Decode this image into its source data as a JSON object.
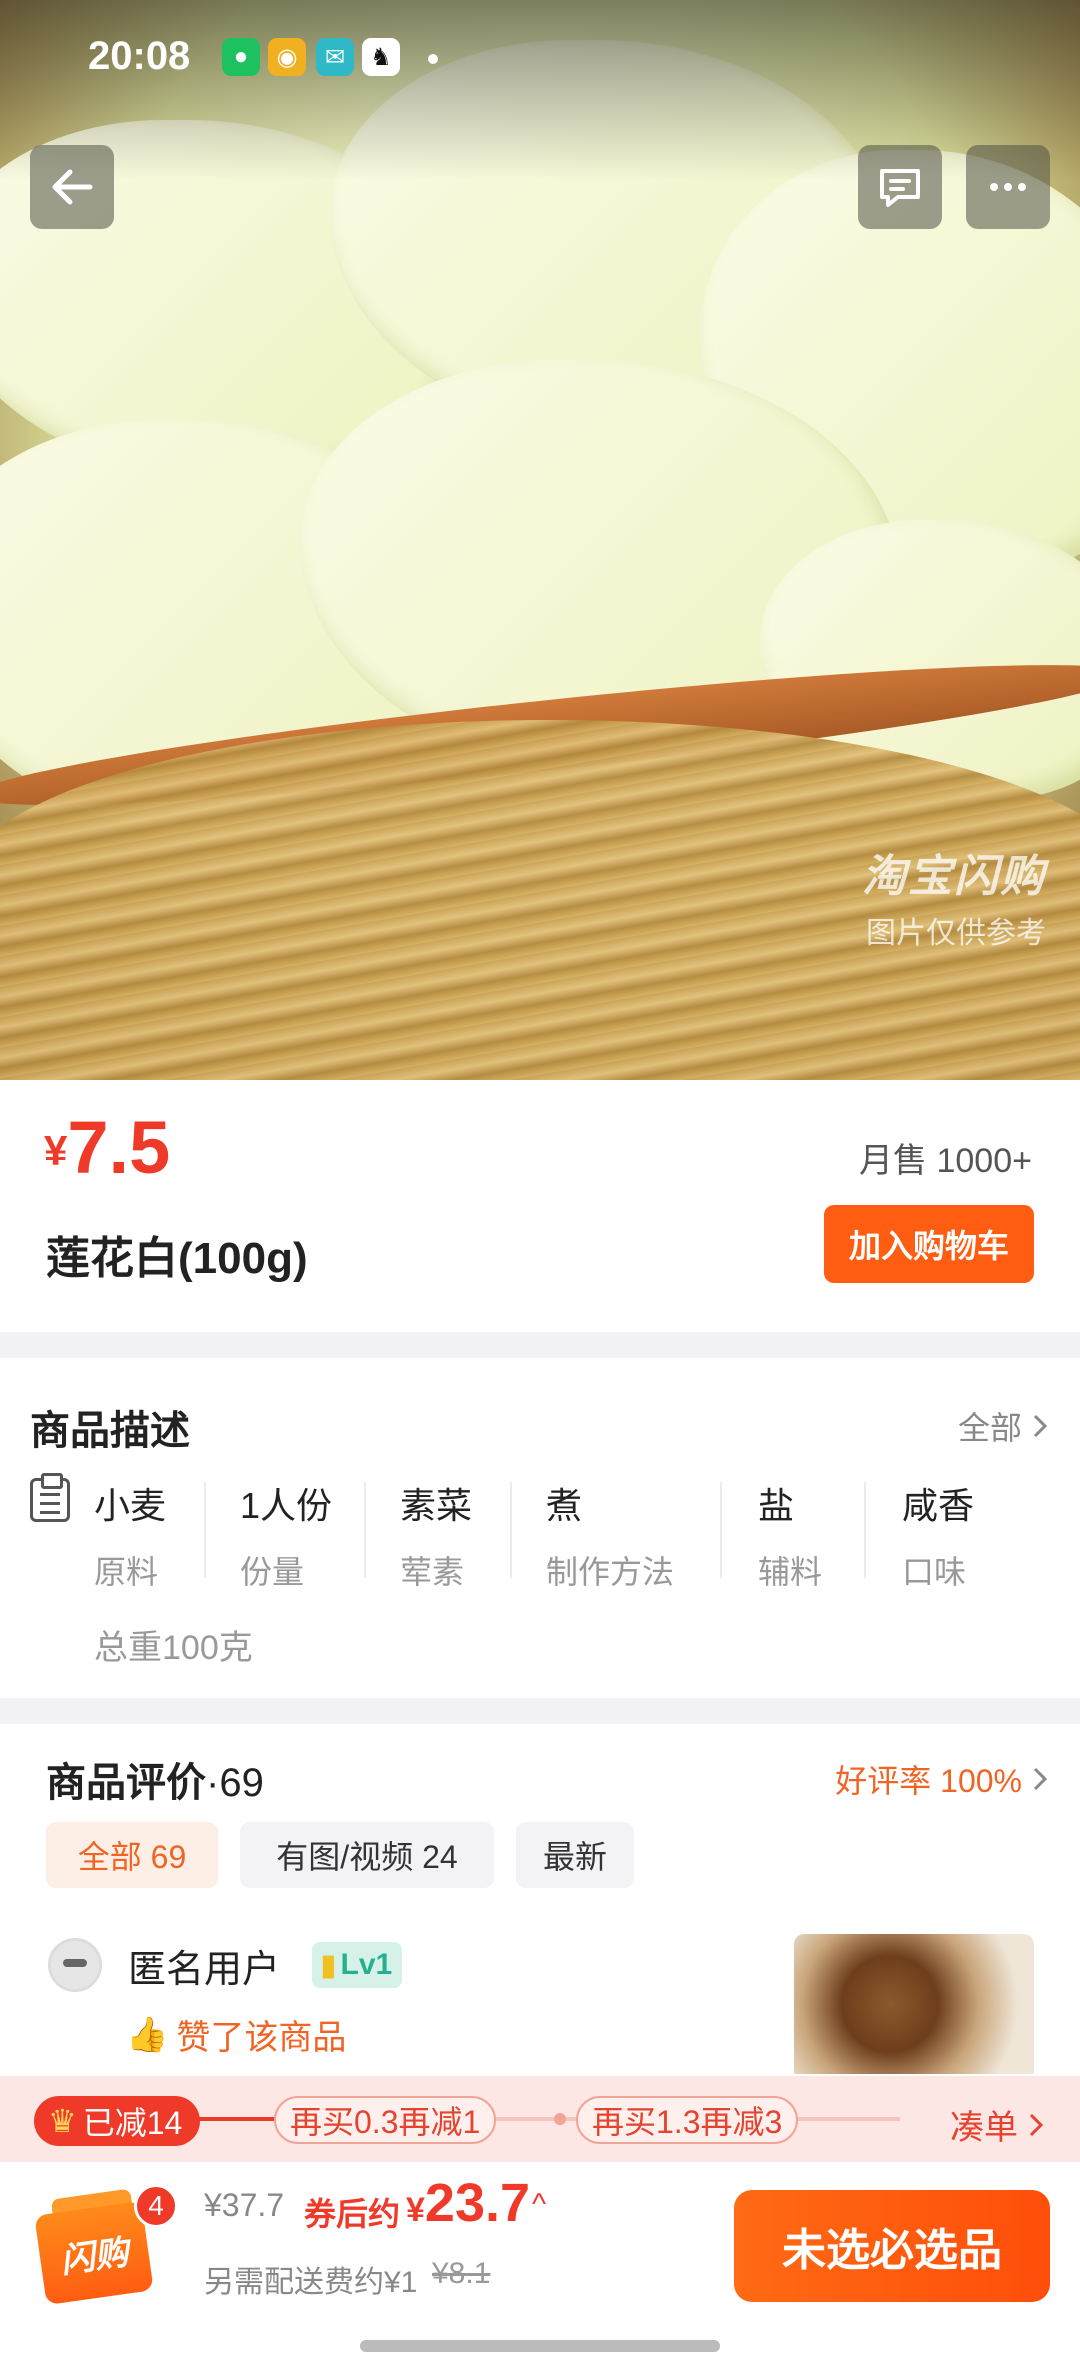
{
  "status_bar": {
    "time": "20:08"
  },
  "hero": {
    "watermark_brand": "淘宝闪购",
    "watermark_note": "图片仅供参考"
  },
  "product": {
    "currency": "¥",
    "price": "7.5",
    "monthly_sales": "月售 1000+",
    "name": "莲花白(100g)",
    "add_to_cart": "加入购物车"
  },
  "description": {
    "title": "商品描述",
    "more": "全部",
    "attributes": [
      {
        "value": "小麦",
        "label": "原料"
      },
      {
        "value": "1人份",
        "label": "份量"
      },
      {
        "value": "素菜",
        "label": "荤素"
      },
      {
        "value": "煮",
        "label": "制作方法"
      },
      {
        "value": "盐",
        "label": "辅料"
      },
      {
        "value": "咸香",
        "label": "口味"
      }
    ],
    "weight": "总重100克"
  },
  "reviews": {
    "title": "商品评价",
    "count": "·69",
    "rate": "好评率 100%",
    "filters": [
      {
        "label": "全部 69",
        "active": true
      },
      {
        "label": "有图/视频 24",
        "active": false
      },
      {
        "label": "最新",
        "active": false
      }
    ],
    "first": {
      "user": "匿名用户",
      "level": "Lv1",
      "liked": "赞了该商品"
    }
  },
  "discount": {
    "done": "已减14",
    "step1": "再买0.3再减1",
    "step2": "再买1.3再减3",
    "together": "凑单"
  },
  "bottom": {
    "cart_count": "4",
    "cart_brand": "闪购",
    "original_total": "¥37.7",
    "after_coupon_label": "券后约",
    "final_currency": "¥",
    "final_price": "23.7",
    "shipping": "另需配送费约¥1",
    "shipping_old": "¥8.1",
    "checkout": "未选必选品"
  },
  "colors": {
    "accent": "#ff5d11",
    "price_red": "#ef3a2a",
    "strip_bg": "#fde7e4"
  }
}
